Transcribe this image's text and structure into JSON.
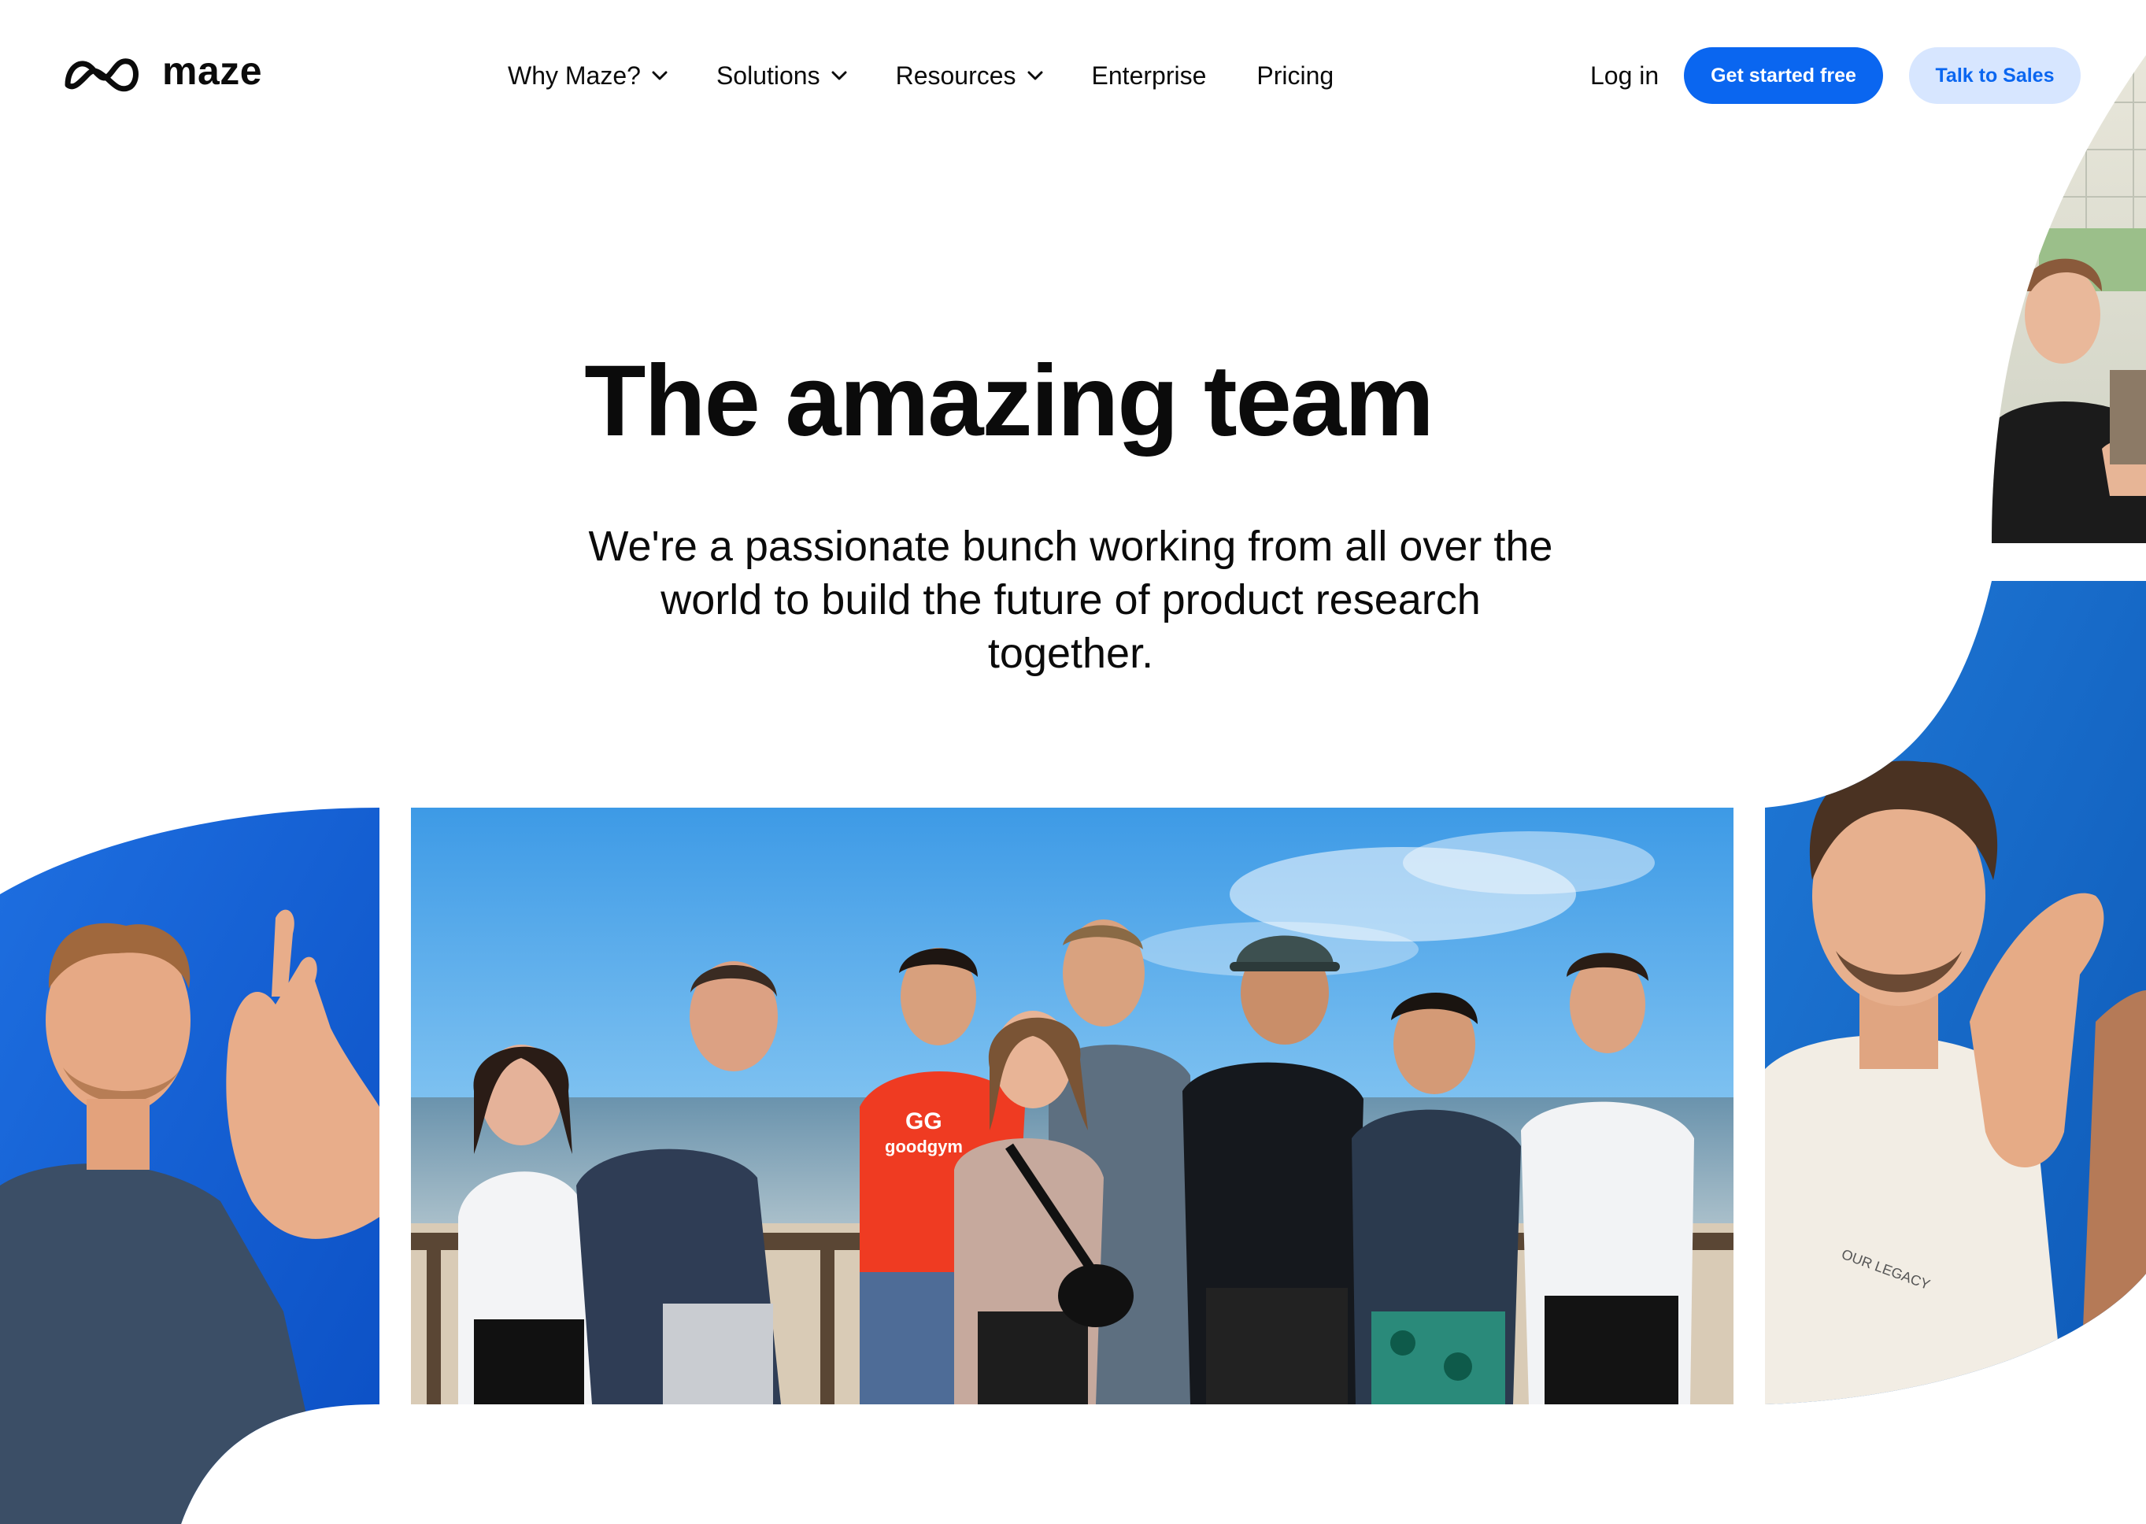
{
  "brand": {
    "name": "maze",
    "logo_icon": "maze-logo-icon"
  },
  "nav": {
    "items": [
      {
        "label": "Why Maze?",
        "has_dropdown": true
      },
      {
        "label": "Solutions",
        "has_dropdown": true
      },
      {
        "label": "Resources",
        "has_dropdown": true
      },
      {
        "label": "Enterprise",
        "has_dropdown": false
      },
      {
        "label": "Pricing",
        "has_dropdown": false
      }
    ],
    "login": "Log in",
    "cta_primary": "Get started free",
    "cta_secondary": "Talk to Sales"
  },
  "hero": {
    "title": "The amazing team",
    "subtitle": "We're a passionate bunch working from all over the world to build the future of product research together."
  },
  "photos": {
    "main": {
      "shirt_text": "goodgym",
      "shirt_logo": "GG"
    },
    "right": {
      "shirt_text": "OUR LEGACY"
    }
  },
  "colors": {
    "primary": "#0a66f0",
    "secondary_bg": "#d7e6ff",
    "text": "#0b0b0b",
    "background": "#ffffff"
  }
}
